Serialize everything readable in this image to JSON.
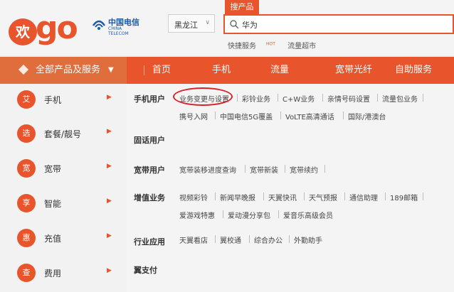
{
  "header": {
    "logo_huan": "欢",
    "logo_go": "go",
    "telecom_cn": "中国电信",
    "telecom_en": "CHINA TELECOM",
    "region": "黑龙江",
    "search_tab": "搜产品",
    "search_value": "华为",
    "quick_links": [
      {
        "label": "快捷服务",
        "badge": "HOT"
      },
      {
        "label": "流量超市",
        "badge": ""
      }
    ]
  },
  "nav": {
    "all_products": "全部产品及服务",
    "items": [
      "首页",
      "手机",
      "流量",
      "宽带光纤",
      "自助服务"
    ]
  },
  "sidebar": {
    "items": [
      {
        "icon": "艾",
        "label": "手机"
      },
      {
        "icon": "选",
        "label": "套餐/靓号"
      },
      {
        "icon": "宽",
        "label": "宽带"
      },
      {
        "icon": "享",
        "label": "智能"
      },
      {
        "icon": "惠",
        "label": "充值"
      },
      {
        "icon": "查",
        "label": "费用"
      }
    ]
  },
  "content": {
    "rows": [
      {
        "label": "手机用户",
        "lines": [
          [
            "业务变更与设置",
            "彩铃业务",
            "C+W业务",
            "亲情号码设置",
            "流量包业务"
          ],
          [
            "携号入网",
            "中国电信5G覆盖",
            "VoLTE高清通话",
            "国际/港澳台"
          ]
        ]
      },
      {
        "label": "固话用户",
        "lines": []
      },
      {
        "label": "宽带用户",
        "lines": [
          [
            "宽带装移进度查询",
            "宽带新装",
            "宽带续约"
          ]
        ]
      },
      {
        "label": "增值业务",
        "lines": [
          [
            "视频彩铃",
            "新闻早晚报",
            "天翼快讯",
            "天气预报",
            "通信助理",
            "189邮箱"
          ],
          [
            "爱游戏特惠",
            "爱动漫分享包",
            "爱音乐高级会员"
          ]
        ]
      },
      {
        "label": "行业应用",
        "lines": [
          [
            "天翼看店",
            "翼校通",
            "综合办公",
            "外勤助手"
          ]
        ]
      },
      {
        "label": "翼支付",
        "lines": []
      }
    ]
  },
  "colors": {
    "brand_orange": "#e8542b",
    "highlight_red": "#d8232a"
  }
}
